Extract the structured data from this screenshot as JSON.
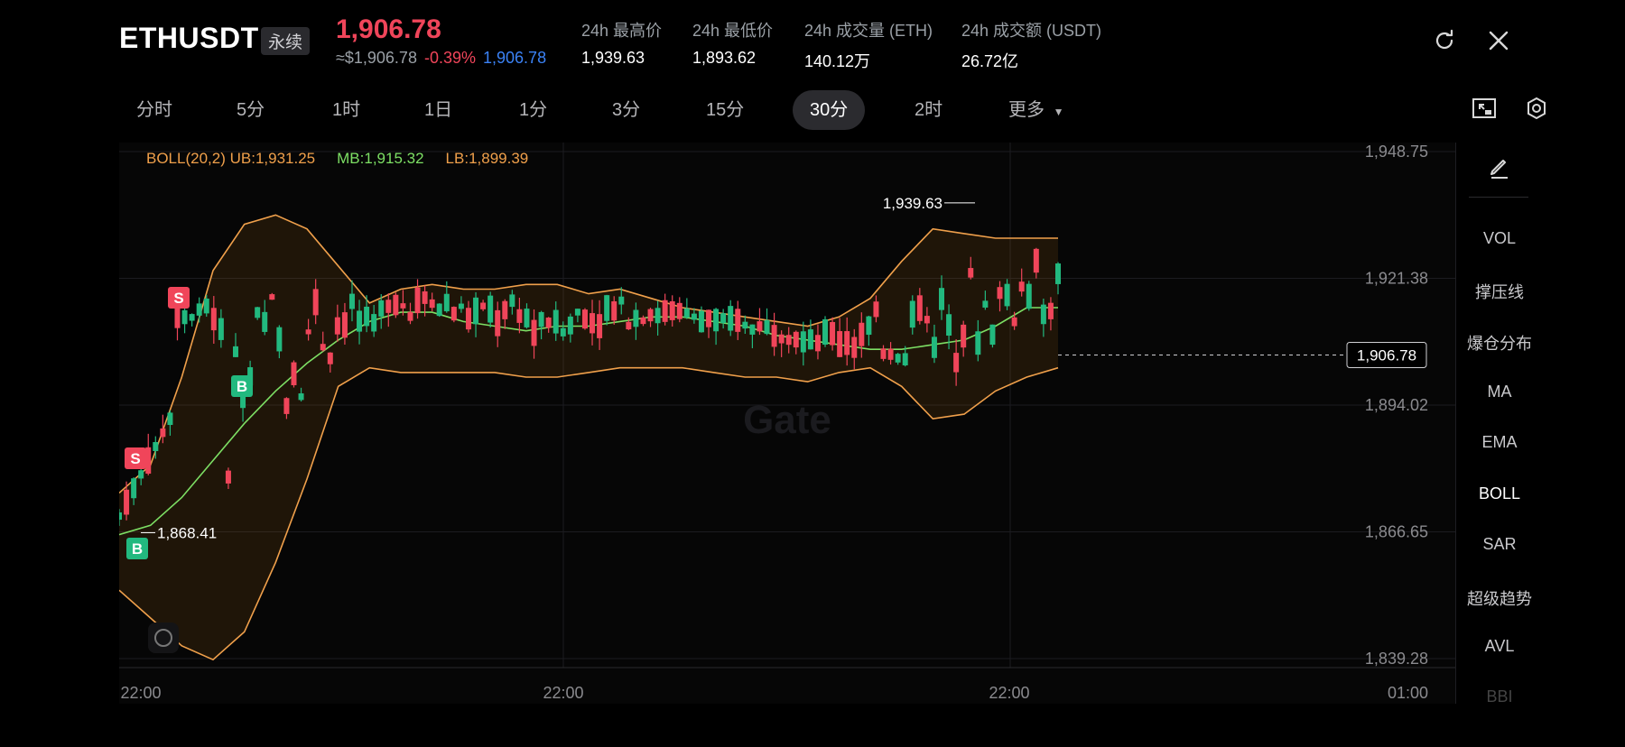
{
  "header": {
    "symbol": "ETHUSDT",
    "contract_tag": "永续",
    "last_price": "1,906.78",
    "approx_price": "≈$1,906.78",
    "change_pct": "-0.39%",
    "mark_price": "1,906.78",
    "stats": [
      {
        "label": "24h 最高价",
        "value": "1,939.63"
      },
      {
        "label": "24h 最低价",
        "value": "1,893.62"
      },
      {
        "label": "24h 成交量 (ETH)",
        "value": "140.12万"
      },
      {
        "label": "24h 成交额 (USDT)",
        "value": "26.72亿"
      }
    ]
  },
  "intervals": {
    "items": [
      "分时",
      "5分",
      "1时",
      "1日",
      "1分",
      "3分",
      "15分",
      "30分",
      "2时",
      "更多"
    ],
    "selected": "30分"
  },
  "indicator_legend": {
    "boll": "BOLL(20,2)",
    "ub": "UB:1,931.25",
    "mb": "MB:1,915.32",
    "lb": "LB:1,899.39"
  },
  "price_axis": [
    "1,948.75",
    "1,921.38",
    "1,894.02",
    "1,866.65",
    "1,839.28"
  ],
  "time_axis": [
    "22:00",
    "22:00",
    "22:00",
    "01:00"
  ],
  "annotations": {
    "high_label": "1,939.63",
    "low_label": "1,868.41",
    "current_price_label": "1,906.78",
    "sell_marker": "S",
    "buy_marker": "B"
  },
  "watermark": "Gate",
  "sidebar": {
    "items": [
      "VOL",
      "撑压线",
      "爆仓分布",
      "MA",
      "EMA",
      "BOLL",
      "SAR",
      "超级趋势",
      "AVL",
      "BBI"
    ],
    "active": "BOLL"
  },
  "colors": {
    "up": "#22b97f",
    "down": "#f0455a",
    "ub_lb": "#f0a04b",
    "mb": "#7ddf64",
    "accent_blue": "#3b82f6"
  },
  "chart_data": {
    "type": "candlestick",
    "y_range": [
      1839.28,
      1948.75
    ],
    "mb_line": [
      1868,
      1870,
      1876,
      1884,
      1892,
      1899,
      1905,
      1910,
      1914,
      1916,
      1916,
      1914,
      1913,
      1912,
      1913,
      1913,
      1914,
      1915,
      1915,
      1914,
      1913,
      1911,
      1910,
      1909,
      1908,
      1908,
      1909,
      1910,
      1913,
      1917,
      1917
    ],
    "ub_line": [
      1877,
      1883,
      1902,
      1925,
      1935,
      1937,
      1934,
      1926,
      1918,
      1921,
      1922,
      1921,
      1921,
      1922,
      1922,
      1920,
      1921,
      1919,
      1917,
      1916,
      1915,
      1914,
      1913,
      1915,
      1919,
      1927,
      1934,
      1933,
      1932,
      1932,
      1932
    ],
    "lb_line": [
      1856,
      1850,
      1844,
      1841,
      1847,
      1862,
      1880,
      1900,
      1904,
      1903,
      1903,
      1903,
      1903,
      1902,
      1902,
      1903,
      1904,
      1904,
      1904,
      1903,
      1902,
      1902,
      1901,
      1903,
      1904,
      1900,
      1893,
      1894,
      1899,
      1902,
      1904
    ],
    "high": 1939.63,
    "low": 1868.41,
    "last": 1906.78
  }
}
